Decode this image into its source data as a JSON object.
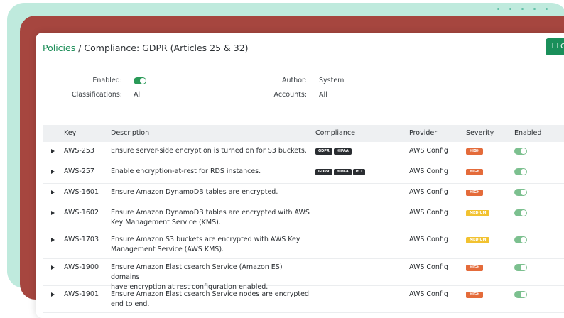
{
  "breadcrumb": {
    "link": "Policies",
    "separator": " / ",
    "current": "Compliance: GDPR (Articles 25 & 32)"
  },
  "copy_button": {
    "label": "C"
  },
  "meta": {
    "enabled_label": "Enabled:",
    "enabled_on": true,
    "author_label": "Author:",
    "author_value": "System",
    "classifications_label": "Classifications:",
    "classifications_value": "All",
    "accounts_label": "Accounts:",
    "accounts_value": "All"
  },
  "table": {
    "columns": {
      "key": "Key",
      "description": "Description",
      "compliance": "Compliance",
      "provider": "Provider",
      "severity": "Severity",
      "enabled": "Enabled"
    },
    "rows": [
      {
        "key": "AWS-253",
        "description_lines": [
          "Ensure server-side encryption is turned on for S3 buckets."
        ],
        "compliance": [
          "GDPR",
          "HIPAA"
        ],
        "provider": "AWS Config",
        "severity": "HIGH",
        "enabled": true
      },
      {
        "key": "AWS-257",
        "description_lines": [
          "Enable encryption-at-rest for RDS instances."
        ],
        "compliance": [
          "GDPR",
          "HIPAA",
          "PCI"
        ],
        "provider": "AWS Config",
        "severity": "HIGH",
        "enabled": true
      },
      {
        "key": "AWS-1601",
        "description_lines": [
          "Ensure Amazon DynamoDB tables are encrypted."
        ],
        "compliance": [],
        "provider": "AWS Config",
        "severity": "HIGH",
        "enabled": true
      },
      {
        "key": "AWS-1602",
        "description_lines": [
          "Ensure Amazon DynamoDB tables are encrypted with AWS",
          "Key Management Service (KMS)."
        ],
        "compliance": [],
        "provider": "AWS Config",
        "severity": "MEDIUM",
        "enabled": true
      },
      {
        "key": "AWS-1703",
        "description_lines": [
          "Ensure Amazon S3 buckets are encrypted with AWS Key",
          "Management Service (AWS KMS)."
        ],
        "compliance": [],
        "provider": "AWS Config",
        "severity": "MEDIUM",
        "enabled": true
      },
      {
        "key": "AWS-1900",
        "description_lines": [
          "Ensure Amazon Elasticsearch Service (Amazon ES) domains",
          "have encryption at rest configuration enabled."
        ],
        "compliance": [],
        "provider": "AWS Config",
        "severity": "HIGH",
        "enabled": true
      },
      {
        "key": "AWS-1901",
        "description_lines": [
          "Ensure Amazon Elasticsearch Service nodes are encrypted",
          "end to end."
        ],
        "compliance": [],
        "provider": "AWS Config",
        "severity": "HIGH",
        "enabled": true
      }
    ]
  },
  "colors": {
    "accent_green": "#1f8f5a",
    "severity_high": "#e46b3a",
    "severity_medium": "#f2c230",
    "badge_dark": "#2a2d31",
    "frame_red": "#a6463f",
    "frame_mint": "#bfeadd"
  },
  "icons": {
    "copy": "copy-icon",
    "expand": "caret-right-icon",
    "toggle": "toggle-switch-icon"
  }
}
